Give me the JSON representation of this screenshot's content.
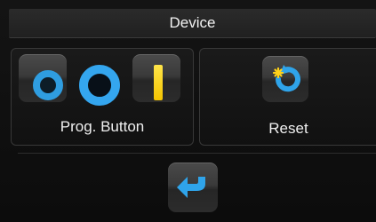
{
  "header": {
    "title": "Device"
  },
  "prog_button": {
    "label": "Prog. Button",
    "icons": [
      "blue-ring-icon",
      "blue-ring-icon",
      "yellow-bar-icon"
    ],
    "colors": {
      "ring": "#34a6ef",
      "bar": "#f4c400"
    }
  },
  "reset": {
    "label": "Reset",
    "icon": "reset-icon",
    "colors": {
      "arrow": "#2fa4ea",
      "spark": "#ffd21a"
    }
  },
  "footer": {
    "back_icon": "back-arrow-icon"
  }
}
